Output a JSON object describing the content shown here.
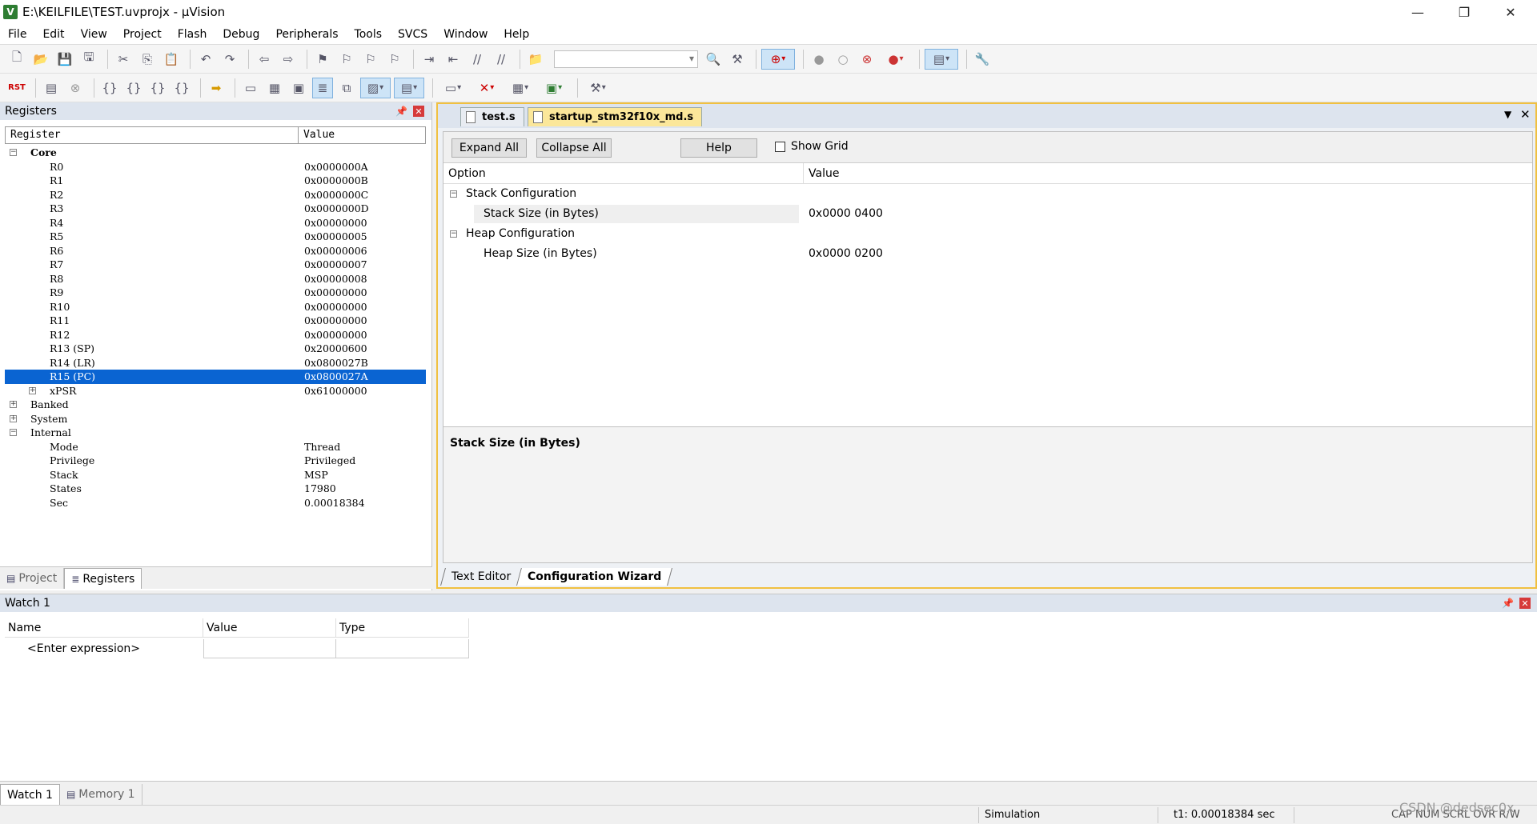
{
  "window": {
    "title": "E:\\KEILFILE\\TEST.uvprojx - µVision",
    "app_icon": "V",
    "min_glyph": "—",
    "max_glyph": "❐",
    "close_glyph": "✕"
  },
  "menu": [
    "File",
    "Edit",
    "View",
    "Project",
    "Flash",
    "Debug",
    "Peripherals",
    "Tools",
    "SVCS",
    "Window",
    "Help"
  ],
  "registers_panel": {
    "title": "Registers",
    "col_register": "Register",
    "col_value": "Value",
    "core_label": "Core",
    "core_regs": [
      {
        "name": "R0",
        "value": "0x0000000A"
      },
      {
        "name": "R1",
        "value": "0x0000000B"
      },
      {
        "name": "R2",
        "value": "0x0000000C"
      },
      {
        "name": "R3",
        "value": "0x0000000D"
      },
      {
        "name": "R4",
        "value": "0x00000000"
      },
      {
        "name": "R5",
        "value": "0x00000005"
      },
      {
        "name": "R6",
        "value": "0x00000006"
      },
      {
        "name": "R7",
        "value": "0x00000007"
      },
      {
        "name": "R8",
        "value": "0x00000008"
      },
      {
        "name": "R9",
        "value": "0x00000000"
      },
      {
        "name": "R10",
        "value": "0x00000000"
      },
      {
        "name": "R11",
        "value": "0x00000000"
      },
      {
        "name": "R12",
        "value": "0x00000000"
      },
      {
        "name": "R13 (SP)",
        "value": "0x20000600"
      },
      {
        "name": "R14 (LR)",
        "value": "0x0800027B"
      },
      {
        "name": "R15 (PC)",
        "value": "0x0800027A"
      },
      {
        "name": "xPSR",
        "value": "0x61000000"
      }
    ],
    "groups": [
      "Banked",
      "System",
      "Internal"
    ],
    "internal": [
      {
        "name": "Mode",
        "value": "Thread"
      },
      {
        "name": "Privilege",
        "value": "Privileged"
      },
      {
        "name": "Stack",
        "value": "MSP"
      },
      {
        "name": "States",
        "value": "17980"
      },
      {
        "name": "Sec",
        "value": "0.00018384"
      }
    ]
  },
  "left_tabs": {
    "project": "Project",
    "registers": "Registers"
  },
  "doc_tabs": {
    "test": "test.s",
    "startup": "startup_stm32f10x_md.s"
  },
  "wizard": {
    "expand_all": "Expand All",
    "collapse_all": "Collapse All",
    "help": "Help",
    "show_grid": "Show Grid",
    "col_option": "Option",
    "col_value": "Value",
    "stack_config": "Stack Configuration",
    "stack_size_label": "Stack Size (in Bytes)",
    "stack_size_value": "0x0000 0400",
    "heap_config": "Heap Configuration",
    "heap_size_label": "Heap Size (in Bytes)",
    "heap_size_value": "0x0000 0200",
    "description_title": "Stack Size (in Bytes)"
  },
  "editor_tabs": {
    "text_editor": "Text Editor",
    "config_wizard": "Configuration Wizard"
  },
  "watch": {
    "title": "Watch 1",
    "col_name": "Name",
    "col_value": "Value",
    "col_type": "Type",
    "enter_expression": "<Enter expression>"
  },
  "bottom_tabs": {
    "watch1": "Watch 1",
    "memory1": "Memory 1"
  },
  "status": {
    "mode": "Simulation",
    "time": "t1: 0.00018384 sec",
    "indicators": "CAP NUM SCRL OVR R/W"
  },
  "watermark": "CSDN @dedsec0x"
}
